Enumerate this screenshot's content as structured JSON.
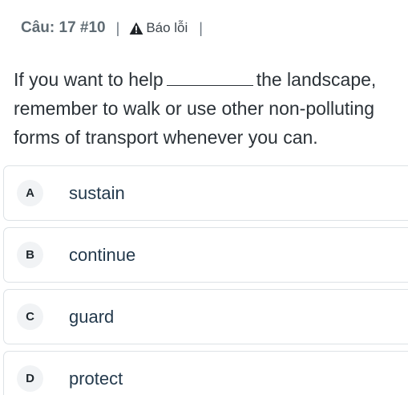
{
  "header": {
    "question_number": "Câu: 17 #10",
    "separator": "|",
    "report_label": "Báo lỗi",
    "report_icon": "warning-triangle-icon"
  },
  "question": {
    "text_before": "If you want to help",
    "text_after": "the landscape, remember to walk or use other non-polluting forms of transport whenever you can."
  },
  "options": [
    {
      "letter": "A",
      "text": "sustain"
    },
    {
      "letter": "B",
      "text": "continue"
    },
    {
      "letter": "C",
      "text": "guard"
    },
    {
      "letter": "D",
      "text": "protect"
    }
  ],
  "colors": {
    "header_text": "#5f6b73",
    "body_text": "#2b3238",
    "option_text": "#243a4d",
    "option_border": "#dde2e6",
    "badge_bg": "#f1f3f5"
  }
}
